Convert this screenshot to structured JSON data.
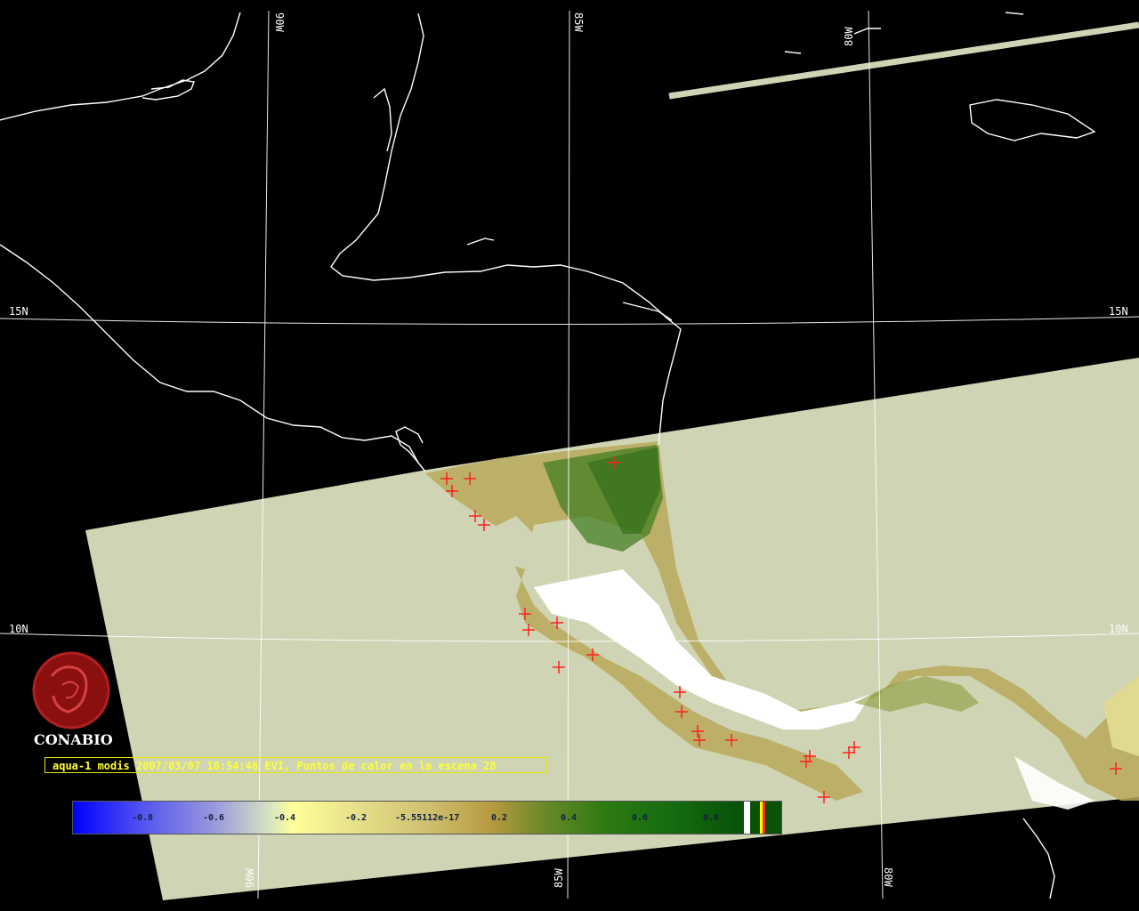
{
  "map": {
    "grid_labels": {
      "lon_top": [
        "90W",
        "85W",
        "80W"
      ],
      "lon_bottom": [
        "90W",
        "85W",
        "80W"
      ],
      "lat_left": [
        "15N",
        "10N"
      ],
      "lat_right": [
        "15N",
        "10N"
      ]
    },
    "colors": {
      "background": "#000000",
      "swath": "#cfd4b4",
      "coastline": "#ffffff",
      "hotspot": "#ff2020",
      "caption": "#ffff33"
    },
    "hotspot_icon": "red-cross-marker"
  },
  "logo": {
    "name": "CONABIO",
    "icon": "conabio-logo-emblem"
  },
  "caption": {
    "text": "aqua-1 modis 2007/03/07 18:54:46 EVI, Puntos de calor en la escena 28"
  },
  "colorbar": {
    "ticks": [
      "-0.8",
      "-0.6",
      "-0.4",
      "-0.2",
      "-5.55112e-17",
      "0.2",
      "0.4",
      "0.6",
      "0.8"
    ]
  }
}
